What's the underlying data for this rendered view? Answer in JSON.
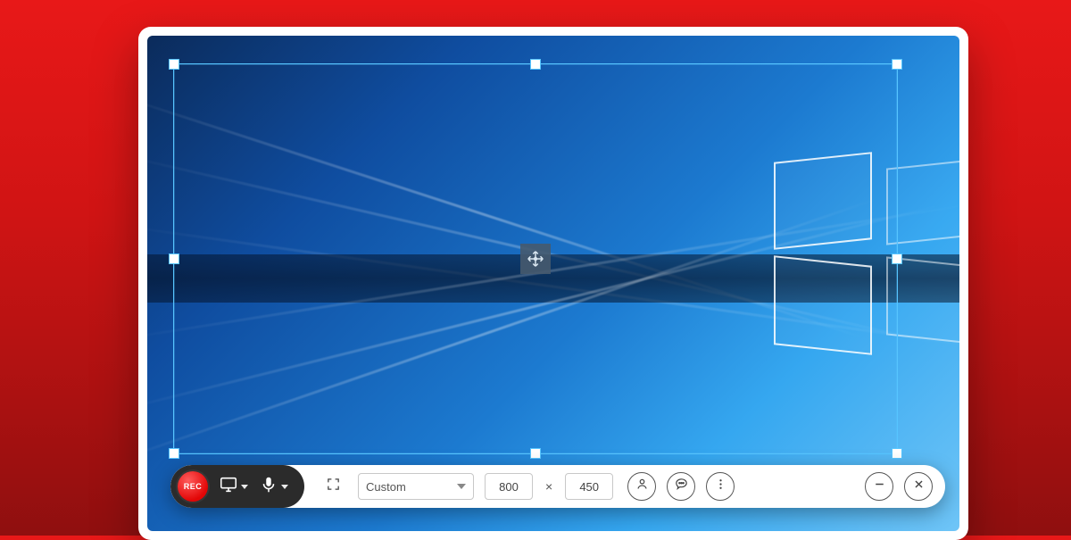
{
  "toolbar": {
    "record_label": "REC",
    "preset_selected": "Custom",
    "width": "800",
    "height": "450",
    "times_symbol": "×"
  },
  "icons": {
    "monitor": "monitor-icon",
    "mic": "mic-icon",
    "fullscreen": "fullscreen-icon",
    "person": "person-icon",
    "annotate": "speech-bubble-icon",
    "more": "more-icon",
    "minimize": "minimize-icon",
    "close": "close-icon",
    "move": "move-icon"
  }
}
